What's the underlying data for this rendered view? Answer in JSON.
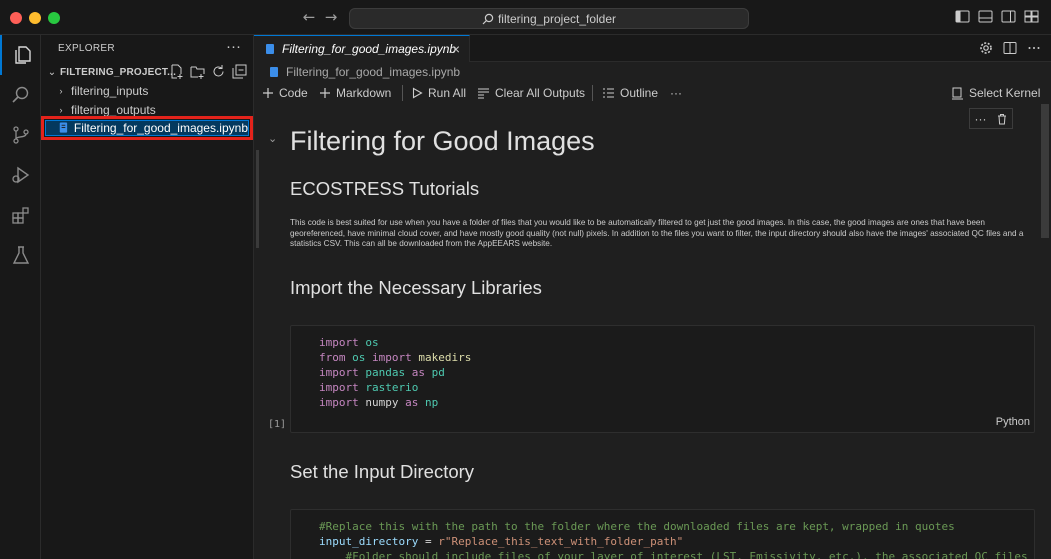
{
  "titlebar": {
    "search_text": "filtering_project_folder"
  },
  "activitybar": {
    "items": [
      "files-icon",
      "search-icon",
      "source-control-icon",
      "run-debug-icon",
      "extensions-icon",
      "testing-icon"
    ]
  },
  "explorer": {
    "title": "EXPLORER",
    "more": "···",
    "folder_name": "FILTERING_PROJECT...",
    "items": [
      {
        "label": "filtering_inputs",
        "type": "folder"
      },
      {
        "label": "filtering_outputs",
        "type": "folder"
      },
      {
        "label": "Filtering_for_good_images.ipynb",
        "type": "notebook",
        "selected": true
      }
    ],
    "highlight_color": "#e3231b"
  },
  "editor_tab": {
    "label": "Filtering_for_good_images.ipynb",
    "close": "×"
  },
  "breadcrumb": {
    "file": "Filtering_for_good_images.ipynb"
  },
  "notebook_toolbar": {
    "code": "Code",
    "markdown": "Markdown",
    "run_all": "Run All",
    "clear_outputs": "Clear All Outputs",
    "outline": "Outline",
    "more": "···",
    "select_kernel": "Select Kernel"
  },
  "notebook": {
    "title": "Filtering for Good Images",
    "subtitle": "ECOSTRESS Tutorials",
    "intro": "This code is best suited for use when you have a folder of files that you would like to be automatically filtered to get just the good images. In this case, the good images are ones that have been georeferenced, have minimal cloud cover, and have mostly good quality (not null) pixels. In addition to the files you want to filter, the input directory should also have the images' associated QC files and a statistics CSV. This can all be downloaded from the AppEEARS website.",
    "section1": "Import the Necessary Libraries",
    "section2": "Set the Input Directory",
    "cell1": {
      "execution_count": "[1]",
      "language": "Python"
    }
  }
}
